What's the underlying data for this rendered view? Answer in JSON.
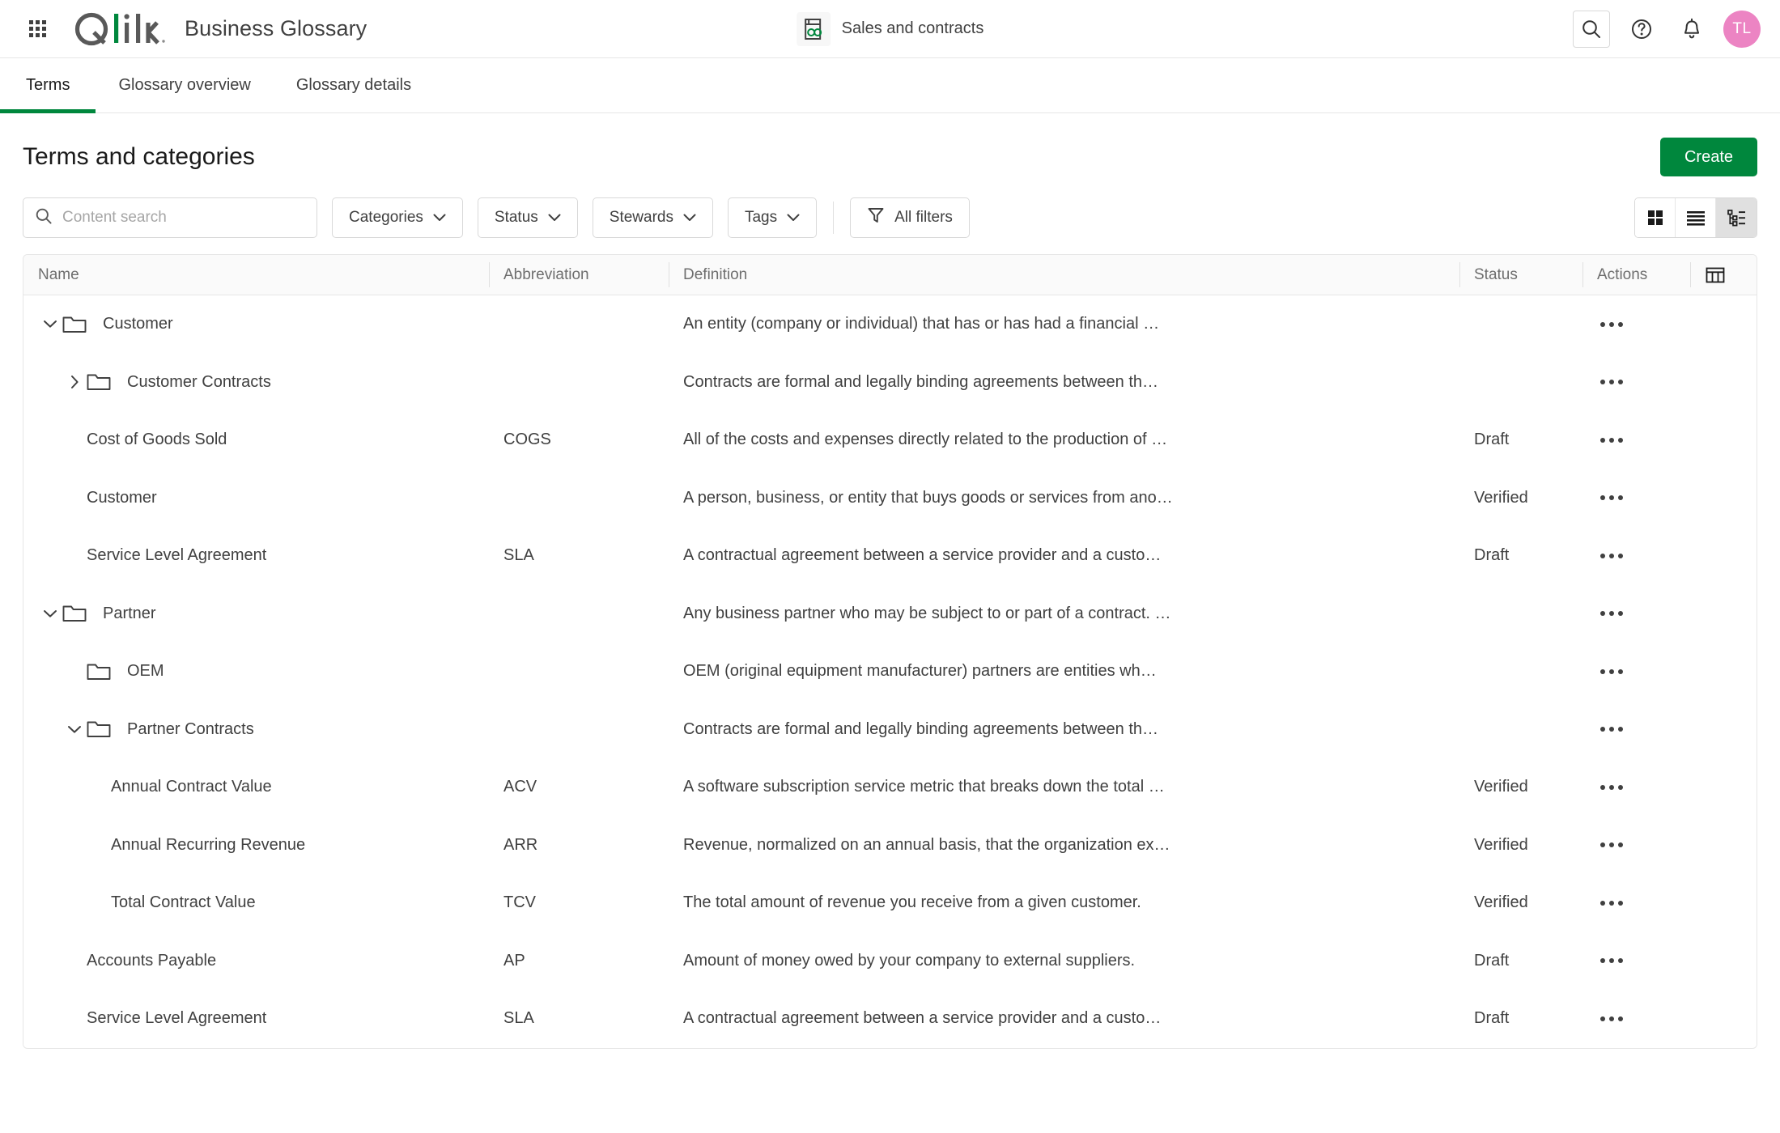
{
  "topbar": {
    "waffle_icon": "app-launcher-grid-icon",
    "logo_text": "Qlik",
    "app_title": "Business Glossary",
    "glossary_chip": {
      "icon": "glossary-book-icon",
      "label": "Sales and contracts"
    },
    "actions": [
      {
        "name": "search-icon",
        "boxed": true
      },
      {
        "name": "help-icon",
        "boxed": false
      },
      {
        "name": "notifications-bell-icon",
        "boxed": false
      }
    ],
    "avatar_initials": "TL"
  },
  "tabs": [
    {
      "label": "Terms",
      "active": true
    },
    {
      "label": "Glossary overview",
      "active": false
    },
    {
      "label": "Glossary details",
      "active": false
    }
  ],
  "header": {
    "title": "Terms and categories",
    "create_label": "Create"
  },
  "filters": {
    "search_placeholder": "Content search",
    "search_value": "",
    "pills": [
      "Categories",
      "Status",
      "Stewards",
      "Tags"
    ],
    "all_filters_label": "All filters",
    "views": [
      {
        "name": "grid-view-icon",
        "active": false
      },
      {
        "name": "list-view-icon",
        "active": false
      },
      {
        "name": "tree-view-icon",
        "active": true
      }
    ]
  },
  "table": {
    "columns": [
      "Name",
      "Abbreviation",
      "Definition",
      "Status",
      "Actions"
    ],
    "column_settings_icon": "table-columns-icon",
    "rows": [
      {
        "name": "Customer",
        "abbreviation": "",
        "definition": "An entity (company or individual) that has or has had a financial …",
        "status": "",
        "type": "folder",
        "level": 0,
        "expander": "chevron-down"
      },
      {
        "name": "Customer Contracts",
        "abbreviation": "",
        "definition": "Contracts are formal and legally binding agreements between th…",
        "status": "",
        "type": "folder",
        "level": 1,
        "expander": "chevron-right"
      },
      {
        "name": "Cost of Goods Sold",
        "abbreviation": "COGS",
        "definition": "All of the costs and expenses directly related to the production of …",
        "status": "Draft",
        "type": "term",
        "level": 1,
        "expander": "none"
      },
      {
        "name": "Customer",
        "abbreviation": "",
        "definition": "A person, business, or entity that buys goods or services from ano…",
        "status": "Verified",
        "type": "term",
        "level": 1,
        "expander": "none"
      },
      {
        "name": "Service Level Agreement",
        "abbreviation": "SLA",
        "definition": "A contractual agreement between a service provider and a custo…",
        "status": "Draft",
        "type": "term",
        "level": 1,
        "expander": "none"
      },
      {
        "name": "Partner",
        "abbreviation": "",
        "definition": "Any business partner who may be subject to or part of a contract. …",
        "status": "",
        "type": "folder",
        "level": 0,
        "expander": "chevron-down"
      },
      {
        "name": "OEM",
        "abbreviation": "",
        "definition": "OEM (original equipment manufacturer) partners are entities wh…",
        "status": "",
        "type": "folder",
        "level": 1,
        "expander": "none"
      },
      {
        "name": "Partner Contracts",
        "abbreviation": "",
        "definition": "Contracts are formal and legally binding agreements between th…",
        "status": "",
        "type": "folder",
        "level": 1,
        "expander": "chevron-down"
      },
      {
        "name": "Annual Contract Value",
        "abbreviation": "ACV",
        "definition": "A software subscription service metric that breaks down the total …",
        "status": "Verified",
        "type": "term",
        "level": 2,
        "expander": "none"
      },
      {
        "name": "Annual Recurring Revenue",
        "abbreviation": "ARR",
        "definition": "Revenue, normalized on an annual basis, that the organization ex…",
        "status": "Verified",
        "type": "term",
        "level": 2,
        "expander": "none"
      },
      {
        "name": "Total Contract Value",
        "abbreviation": "TCV",
        "definition": "The total amount of revenue you receive from a given customer.",
        "status": "Verified",
        "type": "term",
        "level": 2,
        "expander": "none"
      },
      {
        "name": "Accounts Payable",
        "abbreviation": "AP",
        "definition": "Amount of money owed by your company to external suppliers.",
        "status": "Draft",
        "type": "term",
        "level": 1,
        "expander": "none"
      },
      {
        "name": "Service Level Agreement",
        "abbreviation": "SLA",
        "definition": "A contractual agreement between a service provider and a custo…",
        "status": "Draft",
        "type": "term",
        "level": 1,
        "expander": "none"
      }
    ]
  },
  "colors": {
    "brand_green": "#00873D",
    "avatar_pink": "#EC84C3",
    "text_primary": "#404040",
    "text_muted": "#6E6E6E",
    "border": "#E6E6E6"
  }
}
